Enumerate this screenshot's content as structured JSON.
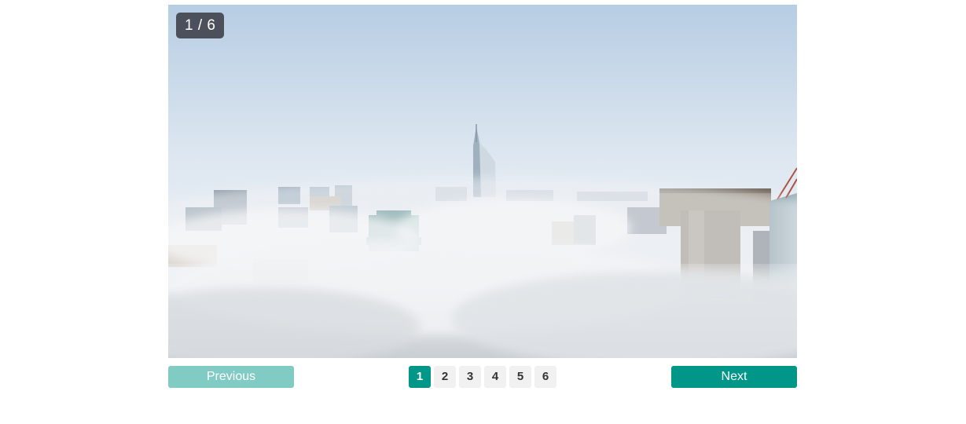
{
  "counter": {
    "current": "1",
    "separator": "/",
    "total": "6",
    "text": "1 / 6"
  },
  "slide": {
    "image": "city-skyline-above-clouds-photo",
    "active_index": 1
  },
  "controls": {
    "previous_label": "Previous",
    "next_label": "Next",
    "pages": [
      "1",
      "2",
      "3",
      "4",
      "5",
      "6"
    ]
  },
  "colors": {
    "accent": "#009688",
    "accent_disabled": "#80cbc4",
    "page_bg": "#f1f1f1",
    "counter_bg": "#373a42"
  }
}
